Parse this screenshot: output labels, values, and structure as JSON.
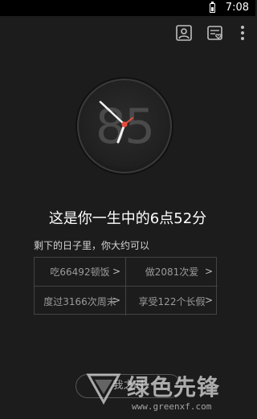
{
  "status_bar": {
    "time": "7:08"
  },
  "action_bar": {
    "icons": [
      "profile-icon",
      "calendar-heart-icon",
      "more-vert-icon"
    ]
  },
  "clock": {
    "number": "85"
  },
  "headline": "这是你一生中的6点52分",
  "subtitle": "剩下的日子里，你大约可以",
  "grid": {
    "cells": [
      {
        "label": "吃66492顿饭",
        "chevron": ">"
      },
      {
        "label": "做2081次爱",
        "chevron": ">"
      },
      {
        "label": "度过3166次周末",
        "chevron": ">"
      },
      {
        "label": "享受122个长假",
        "chevron": ">"
      }
    ]
  },
  "bottom_button": {
    "label": "我之时"
  },
  "watermark": {
    "title": "绿色先锋",
    "url": "www.greenxf.com"
  },
  "colors": {
    "background": "#1c1c1c",
    "status_bar": "#000000",
    "second_hand": "#e84c3d",
    "grid_border": "#444444"
  }
}
